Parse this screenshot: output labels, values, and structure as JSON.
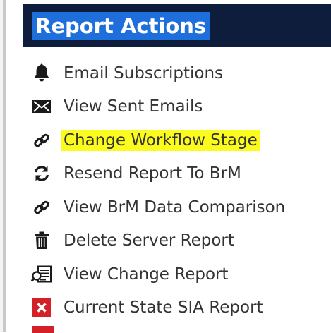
{
  "panel": {
    "title": "Report Actions"
  },
  "menu": {
    "items": [
      {
        "label": "Email Subscriptions",
        "icon": "bell-icon"
      },
      {
        "label": "View Sent Emails",
        "icon": "envelope-icon"
      },
      {
        "label": "Change Workflow Stage",
        "icon": "link-icon",
        "highlighted": true
      },
      {
        "label": "Resend Report To BrM",
        "icon": "refresh-icon"
      },
      {
        "label": "View BrM Data Comparison",
        "icon": "link-icon"
      },
      {
        "label": "Delete Server Report",
        "icon": "trash-icon"
      },
      {
        "label": "View Change Report",
        "icon": "report-icon"
      },
      {
        "label": "Current State SIA Report",
        "icon": "close-box-icon"
      }
    ]
  },
  "colors": {
    "header_bg": "#0f1d3d",
    "title_highlight": "#1e6fdc",
    "text_highlight": "#fbfb1d",
    "icon_dark": "#1a1a1a",
    "icon_red": "#d42027"
  }
}
